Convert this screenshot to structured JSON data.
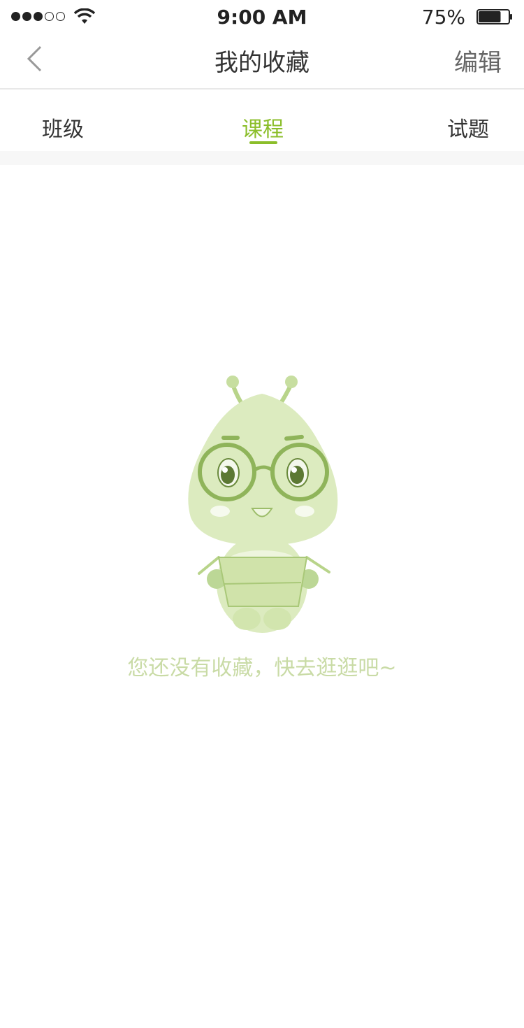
{
  "status_bar": {
    "time": "9:00 AM",
    "battery_percent": "75%",
    "battery_level": 0.75,
    "signal_bars_filled": 3,
    "signal_bars_total": 5
  },
  "nav": {
    "title": "我的收藏",
    "edit_label": "编辑",
    "back_icon": "chevron-left-icon"
  },
  "tabs": [
    {
      "label": "班级",
      "active": false
    },
    {
      "label": "课程",
      "active": true
    },
    {
      "label": "试题",
      "active": false
    }
  ],
  "empty_state": {
    "message": "您还没有收藏，快去逛逛吧~",
    "illustration": "mascot-bug-with-glasses"
  },
  "colors": {
    "accent": "#8bbe2a",
    "empty_text": "#c9dba6",
    "mascot": "#d6e6b4"
  }
}
